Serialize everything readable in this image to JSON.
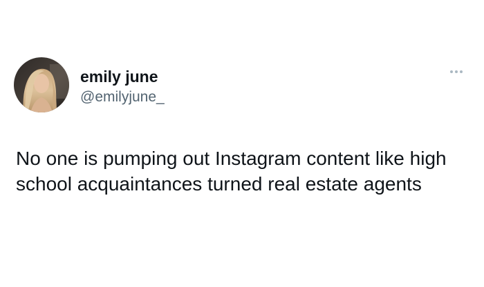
{
  "tweet": {
    "author": {
      "display_name": "emily june",
      "handle": "@emilyjune_"
    },
    "more_icon": "more-horizontal-icon",
    "text": "No one is pumping out Instagram content like high school acquaintances turned real estate agents"
  }
}
